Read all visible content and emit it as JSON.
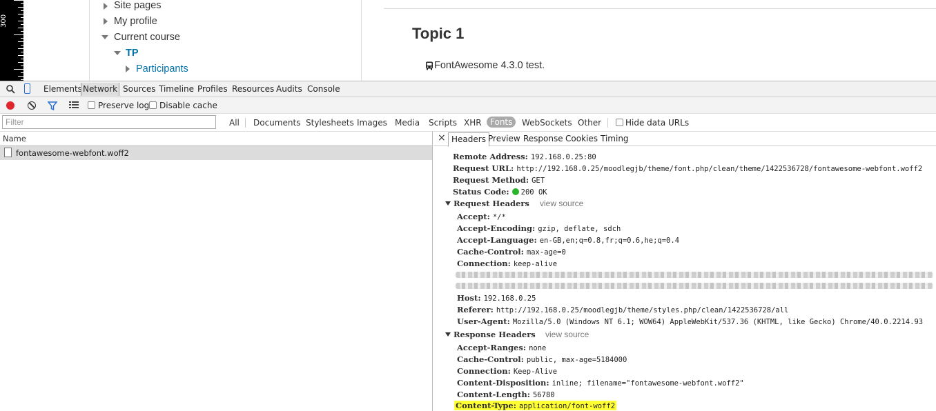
{
  "ruler": {
    "label": "300"
  },
  "page": {
    "nav": {
      "site_pages": "Site pages",
      "my_profile": "My profile",
      "current_course": "Current course",
      "course_code": "TP",
      "participants": "Participants"
    },
    "topic_title": "Topic 1",
    "fa_test": "FontAwesome 4.3.0 test."
  },
  "devtools": {
    "tabs": [
      "Elements",
      "Network",
      "Sources",
      "Timeline",
      "Profiles",
      "Resources",
      "Audits",
      "Console"
    ],
    "active_tab": "Network",
    "toolbar": {
      "preserve_log": "Preserve log",
      "disable_cache": "Disable cache"
    },
    "filter": {
      "placeholder": "Filter",
      "types": [
        "All",
        "Documents",
        "Stylesheets",
        "Images",
        "Media",
        "Scripts",
        "XHR",
        "Fonts",
        "WebSockets",
        "Other"
      ],
      "active_type": "Fonts",
      "hide_data_urls": "Hide data URLs"
    },
    "request_list": {
      "column_name": "Name",
      "rows": [
        "fontawesome-webfont.woff2"
      ]
    },
    "details": {
      "tabs": [
        "Headers",
        "Preview",
        "Response",
        "Cookies",
        "Timing"
      ],
      "active_tab": "Headers",
      "general": [
        {
          "key": "Remote Address:",
          "value": "192.168.0.25:80"
        },
        {
          "key": "Request URL:",
          "value": "http://192.168.0.25/moodlegjb/theme/font.php/clean/theme/1422536728/fontawesome-webfont.woff2"
        },
        {
          "key": "Request Method:",
          "value": "GET"
        },
        {
          "key": "Status Code:",
          "value": "200 OK"
        }
      ],
      "request_headers_title": "Request Headers",
      "request_view_source": "view source",
      "request_headers": [
        {
          "key": "Accept:",
          "value": "*/*"
        },
        {
          "key": "Accept-Encoding:",
          "value": "gzip, deflate, sdch"
        },
        {
          "key": "Accept-Language:",
          "value": "en-GB,en;q=0.8,fr;q=0.6,he;q=0.4"
        },
        {
          "key": "Cache-Control:",
          "value": "max-age=0"
        },
        {
          "key": "Connection:",
          "value": "keep-alive"
        }
      ],
      "request_headers_after": [
        {
          "key": "Host:",
          "value": "192.168.0.25"
        },
        {
          "key": "Referer:",
          "value": "http://192.168.0.25/moodlegjb/theme/styles.php/clean/1422536728/all"
        },
        {
          "key": "User-Agent:",
          "value": "Mozilla/5.0 (Windows NT 6.1; WOW64) AppleWebKit/537.36 (KHTML, like Gecko) Chrome/40.0.2214.93"
        }
      ],
      "response_headers_title": "Response Headers",
      "response_view_source": "view source",
      "response_headers": [
        {
          "key": "Accept-Ranges:",
          "value": "none"
        },
        {
          "key": "Cache-Control:",
          "value": "public, max-age=5184000"
        },
        {
          "key": "Connection:",
          "value": "Keep-Alive"
        },
        {
          "key": "Content-Disposition:",
          "value": "inline; filename=\"fontawesome-webfont.woff2\""
        },
        {
          "key": "Content-Length:",
          "value": "56780"
        },
        {
          "key": "Content-Type:",
          "value": "application/font-woff2"
        }
      ]
    }
  },
  "colors": {
    "record": "#e0262c",
    "status_ok": "#2bb42b",
    "highlight": "#ffff33",
    "link": "#0070a8"
  }
}
